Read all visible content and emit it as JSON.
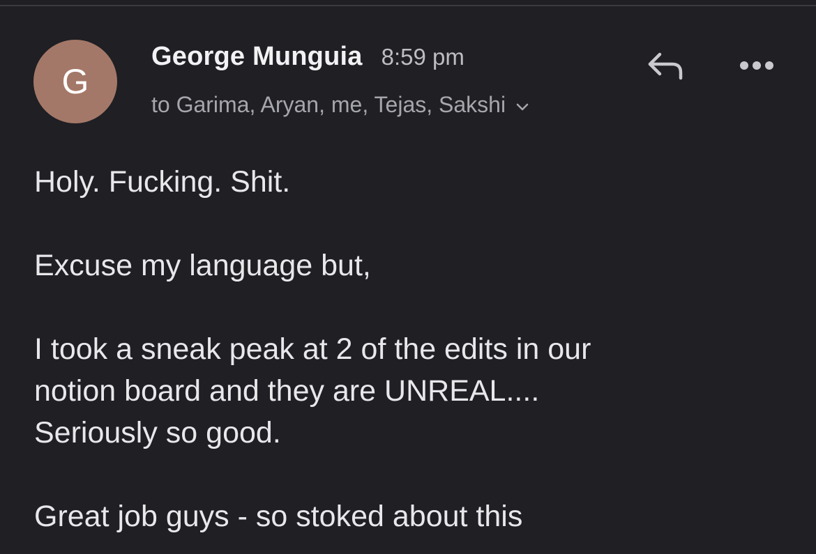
{
  "email": {
    "sender": {
      "initial": "G",
      "name": "George Munguia",
      "time": "8:59 pm",
      "avatar_color": "#a47868"
    },
    "recipients_text": "to Garima, Aryan, me, Tejas, Sakshi",
    "actions": {
      "reply_icon": "reply-icon",
      "more_icon": "more-horizontal-icon"
    },
    "body": {
      "paragraph_1": "Holy. Fucking. Shit.",
      "paragraph_2": "Excuse my language but,",
      "paragraph_3_line_1": "I took a sneak peak at 2 of the edits in our",
      "paragraph_3_line_2": "notion board and they are UNREAL....",
      "paragraph_3_line_3": "Seriously so good.",
      "paragraph_4": "Great job guys - so stoked about this"
    }
  },
  "colors": {
    "background": "#1f1f24",
    "text_primary": "#e8e8eb",
    "text_secondary": "#a6a6ad"
  }
}
